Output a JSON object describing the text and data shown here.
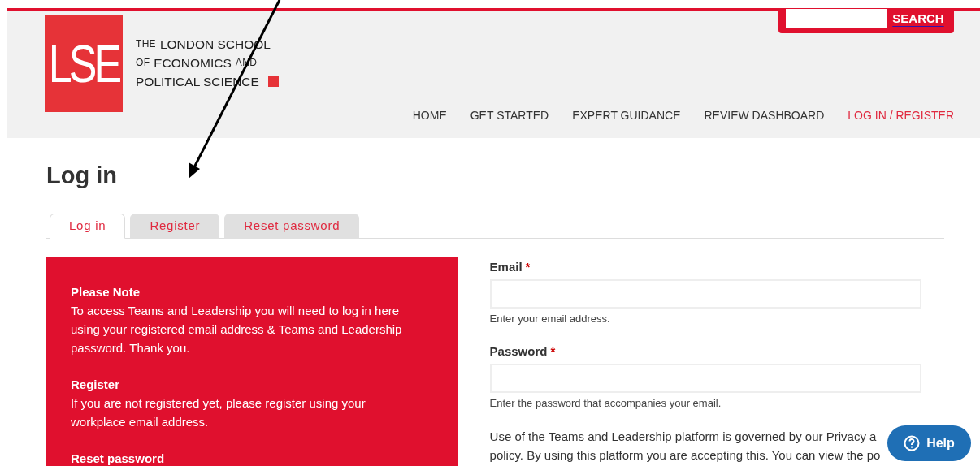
{
  "header": {
    "logo": {
      "mark": "LSE",
      "lines": [
        [
          {
            "text": "THE",
            "small": true
          },
          {
            "text": "LONDON SCHOOL",
            "small": false
          }
        ],
        [
          {
            "text": "OF",
            "small": true
          },
          {
            "text": "ECONOMICS",
            "small": false
          },
          {
            "text": "AND",
            "small": true
          }
        ],
        [
          {
            "text": "POLITICAL SCIENCE",
            "small": false
          }
        ]
      ]
    },
    "search": {
      "button": "SEARCH"
    },
    "nav": [
      {
        "label": "HOME",
        "selected": false
      },
      {
        "label": "GET STARTED",
        "selected": false
      },
      {
        "label": "EXPERT GUIDANCE",
        "selected": false
      },
      {
        "label": "REVIEW DASHBOARD",
        "selected": false
      },
      {
        "label": "LOG IN / REGISTER",
        "selected": true
      }
    ]
  },
  "page_title": "Log in",
  "tabs": [
    {
      "label": "Log in",
      "selected": true
    },
    {
      "label": "Register",
      "selected": false
    },
    {
      "label": "Reset password",
      "selected": false
    }
  ],
  "notice": {
    "sections": [
      {
        "heading": "Please Note",
        "text": "To access Teams and Leadership you will need to log in here using your registered email address & Teams and Leadership password. Thank you."
      },
      {
        "heading": "Register",
        "text": "If you are not registered yet, please register using your workplace email address."
      },
      {
        "heading": "Reset password"
      }
    ]
  },
  "form": {
    "fields": [
      {
        "label": "Email",
        "required_mark": "*",
        "help": "Enter your email address."
      },
      {
        "label": "Password",
        "required_mark": "*",
        "help": "Enter the password that accompanies your email."
      }
    ],
    "policy_lines": [
      "Use of the Teams and Leadership platform is governed by our Privacy a",
      "policy. By using this platform you are accepting this. You can view the po"
    ]
  },
  "help_button": {
    "label": "Help"
  }
}
